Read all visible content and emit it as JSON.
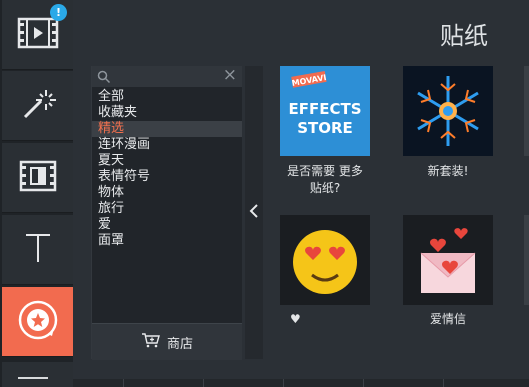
{
  "rail": {
    "badge": "!",
    "items": [
      {
        "name": "media-import-tool",
        "icon": "film-play-icon"
      },
      {
        "name": "effects-tool",
        "icon": "magic-wand-icon"
      },
      {
        "name": "transitions-tool",
        "icon": "film-transition-icon"
      },
      {
        "name": "titles-tool",
        "icon": "text-icon"
      },
      {
        "name": "stickers-tool",
        "icon": "sticker-star-icon"
      }
    ]
  },
  "panel": {
    "title": "贴纸",
    "search_placeholder": "",
    "categories": [
      "全部",
      "收藏夹",
      "精选",
      "连环漫画",
      "夏天",
      "表情符号",
      "物体",
      "旅行",
      "爱",
      "面罩"
    ],
    "selected_category": "精选",
    "store_button": "商店",
    "collapse_icon": "chevron-left-icon"
  },
  "packs": [
    {
      "caption_line1": "是否需要 更多",
      "caption_line2": "贴纸?",
      "art_lines": [
        "MOVAVI",
        "EFFECTS",
        "STORE"
      ]
    },
    {
      "caption_line1": "新套装!",
      "caption_line2": ""
    },
    {
      "caption_line1": "♥",
      "caption_line2": ""
    },
    {
      "caption_line1": "爱情信",
      "caption_line2": ""
    }
  ],
  "colors": {
    "accent": "#f26b4f",
    "selected_text": "#f3714f",
    "badge": "#2aa9e8"
  }
}
